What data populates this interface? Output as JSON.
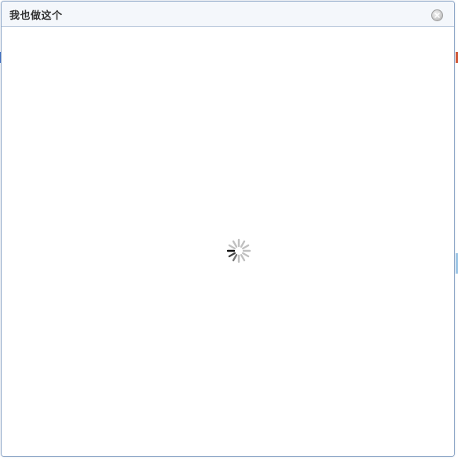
{
  "dialog": {
    "title": "我也做这个",
    "close_icon": "close-icon",
    "loading_icon": "loading-spinner-icon"
  },
  "colors": {
    "border": "#8fa8c8",
    "titlebar_bg": "#f4f7fb",
    "title_text": "#333333",
    "spinner_dark": "#111111",
    "spinner_light": "#c0c0c0"
  }
}
